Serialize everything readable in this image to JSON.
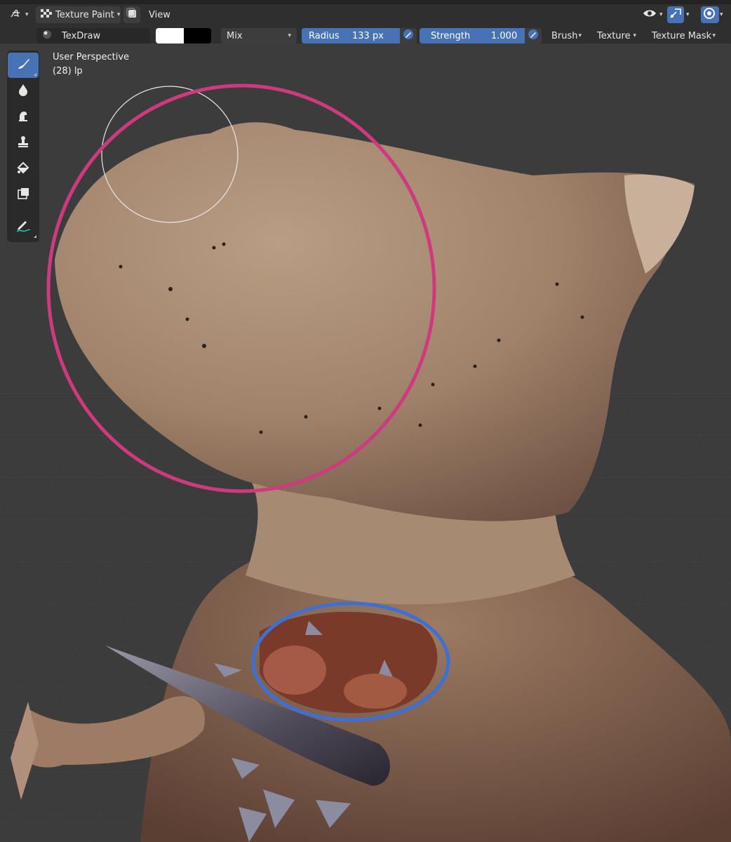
{
  "header": {
    "mode_label": "Texture Paint",
    "view_menu": "View"
  },
  "tool_settings": {
    "brush_name": "TexDraw",
    "color_primary": "#ffffff",
    "color_secondary": "#000000",
    "blend_mode": "Mix",
    "radius_label": "Radius",
    "radius_value": "133 px",
    "strength_label": "Strength",
    "strength_value": "1.000",
    "strength_fill": 1.0,
    "menu_brush": "Brush",
    "menu_texture": "Texture",
    "menu_texture_mask": "Texture Mask"
  },
  "viewport": {
    "perspective": "User Perspective",
    "object_info": "(28) lp"
  },
  "toolbar": {
    "tools": [
      "draw-brush-icon",
      "soften-icon",
      "smear-icon",
      "clone-icon",
      "fill-icon",
      "mask-icon",
      "annotate-icon"
    ],
    "active_index": 0
  },
  "colors": {
    "accent": "#4772b3",
    "annotation_pink": "#cf3a7e",
    "annotation_blue": "#3e6fd1"
  }
}
